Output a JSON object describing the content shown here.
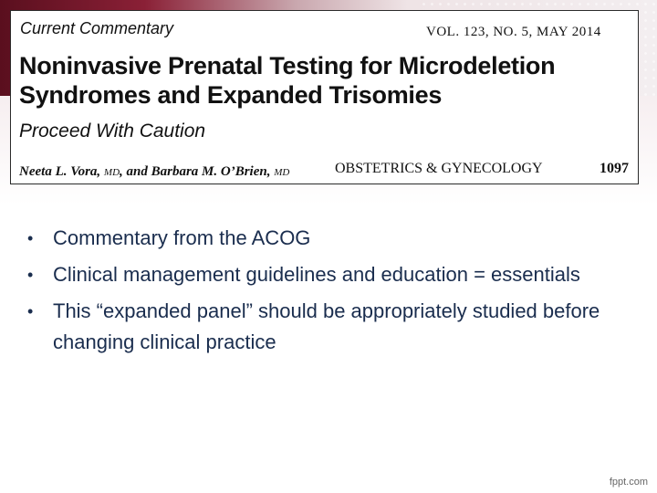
{
  "header": {
    "kicker": "Current Commentary",
    "volume": "VOL. 123, NO. 5, MAY 2014",
    "title_line1": "Noninvasive Prenatal Testing for Microdeletion",
    "title_line2": "Syndromes and Expanded Trisomies",
    "subtitle": "Proceed With Caution",
    "author1": "Neeta L. Vora, ",
    "author1_degree": "MD",
    "author_sep": ", and Barbara M. O’Brien, ",
    "author2_degree": "MD",
    "journal": "OBSTETRICS & GYNECOLOGY",
    "page_number": "1097"
  },
  "bullets": [
    "Commentary from the ACOG",
    "Clinical management guidelines and education = essentials",
    "This “expanded panel” should be appropriately studied before changing clinical practice"
  ],
  "bullet_symbol": "•",
  "footer": {
    "watermark": "fppt.com"
  },
  "colors": {
    "band_dark": "#5a0f1e",
    "band_mid": "#8a2036",
    "bullet_text": "#1a2d4e"
  }
}
